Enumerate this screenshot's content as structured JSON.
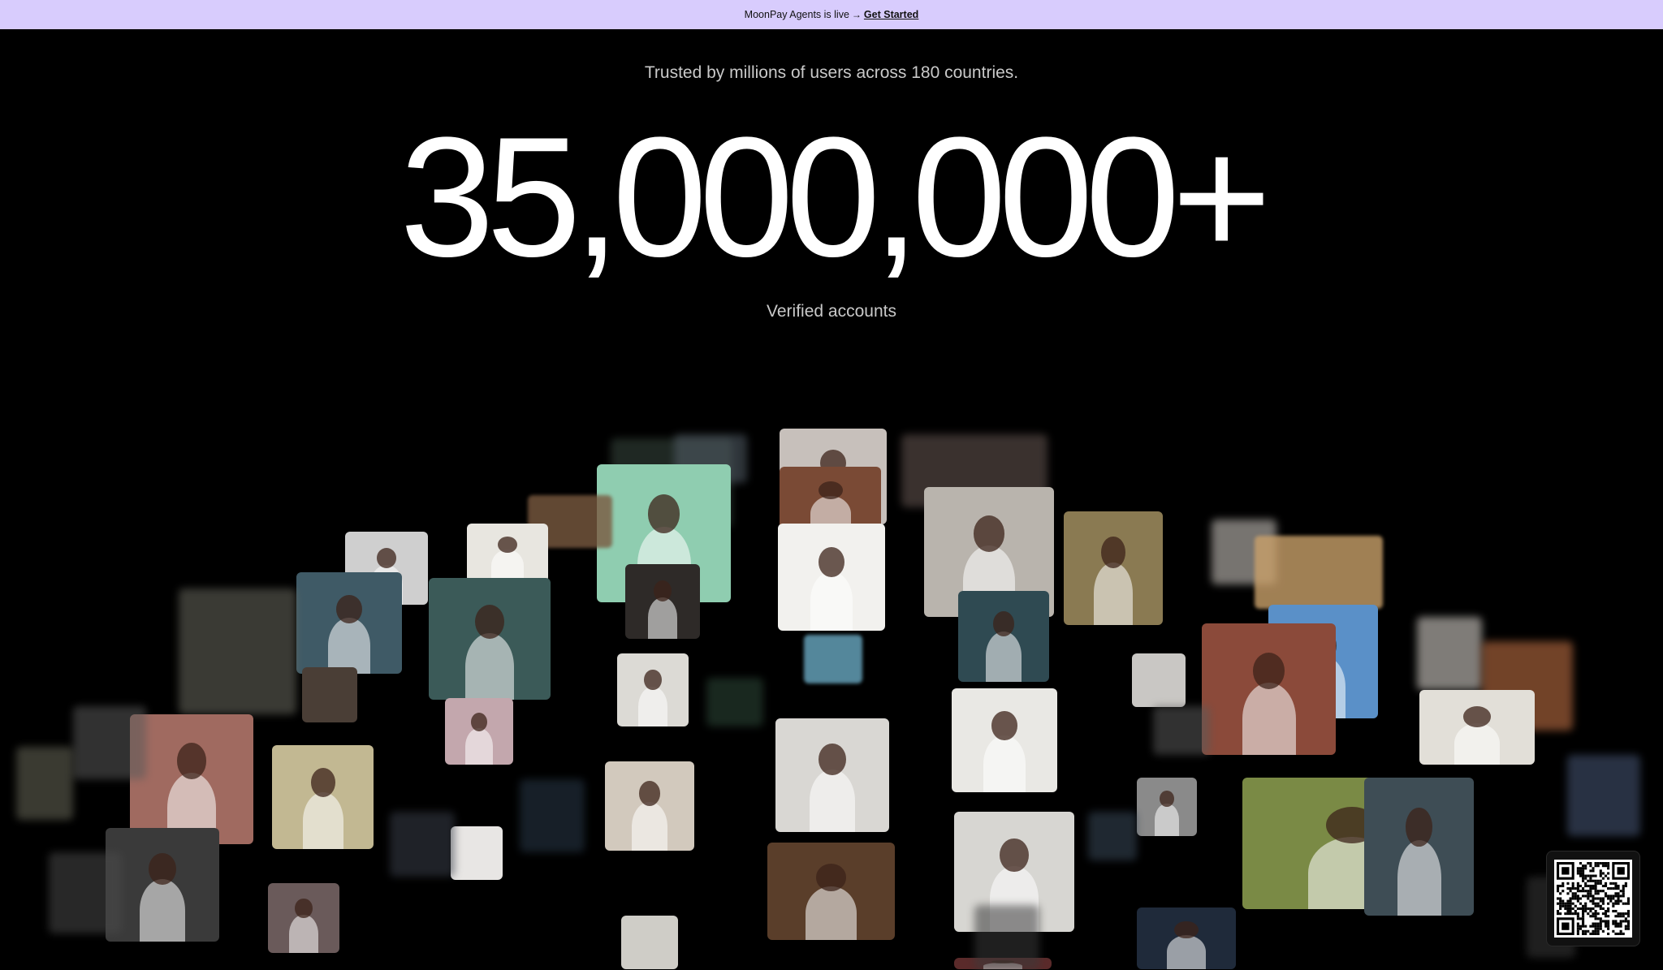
{
  "banner": {
    "text": "MoonPay Agents is live",
    "arrow": "→",
    "link_label": "Get Started",
    "background": "#d8ccfd"
  },
  "hero": {
    "tagline": "Trusted by millions of users across 180 countries.",
    "count": "35,000,000+",
    "count_label": "Verified accounts"
  },
  "qr": {
    "icon": "qr-code-icon"
  }
}
